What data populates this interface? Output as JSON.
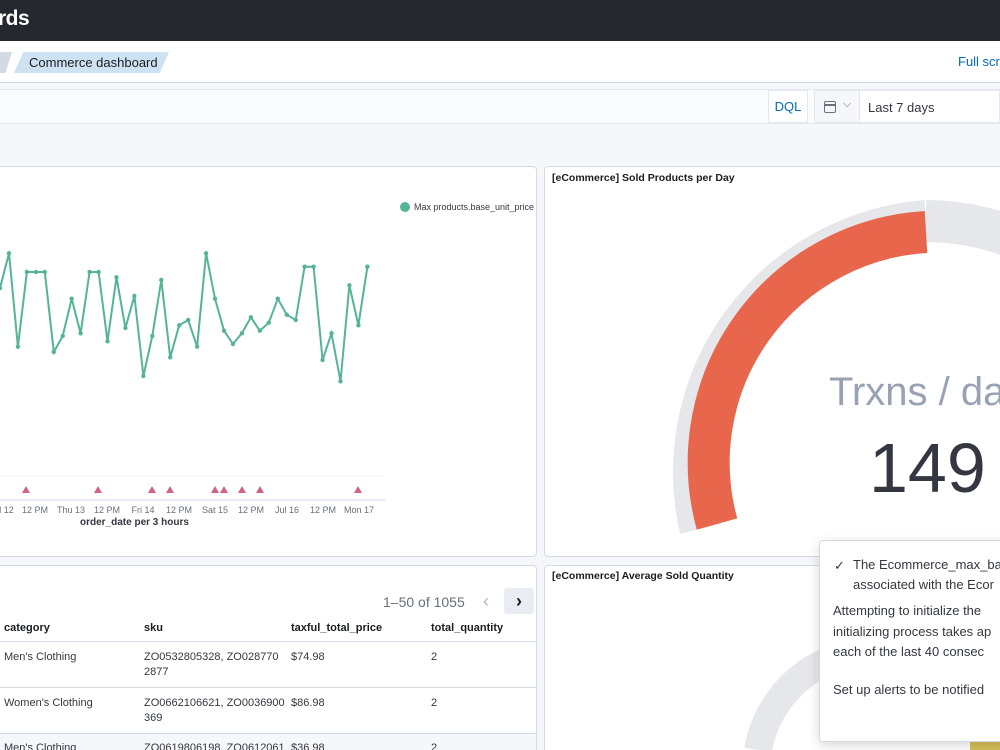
{
  "header": {
    "title": "rds"
  },
  "breadcrumb": {
    "current": "Commerce dashboard",
    "full_screen": "Full scre"
  },
  "query": {
    "language": "DQL",
    "date_range": "Last 7 days"
  },
  "line_panel": {
    "legend": "Max products.base_unit_price",
    "x_axis_title": "order_date per 3 hours",
    "x_ticks": [
      "d 12",
      "12 PM",
      "Thu 13",
      "12 PM",
      "Fri 14",
      "12 PM",
      "Sat 15",
      "12 PM",
      "Jul 16",
      "12 PM",
      "Mon 17"
    ]
  },
  "gauge_panel": {
    "title": "[eCommerce] Sold Products per Day",
    "label": "Trxns / da",
    "value": "149"
  },
  "avg_panel": {
    "title": "[eCommerce] Average Sold Quantity"
  },
  "table": {
    "pagination": "1–50 of 1055",
    "columns": [
      "category",
      "sku",
      "taxful_total_price",
      "total_quantity"
    ],
    "rows": [
      {
        "category": "Men's Clothing",
        "sku_line1": "ZO0532805328, ZO028770",
        "sku_line2": "2877",
        "price": "$74.98",
        "qty": "2"
      },
      {
        "category": "Women's Clothing",
        "sku_line1": "ZO0662106621, ZO0036900",
        "sku_line2": "369",
        "price": "$86.98",
        "qty": "2"
      },
      {
        "category": "Men's Clothing",
        "sku_line1": "ZO0619806198, ZO0612061",
        "sku_line2": "",
        "price": "$36.98",
        "qty": "2"
      }
    ]
  },
  "toast": {
    "lines": [
      "The Ecommerce_max_ba",
      "associated with the Ecor",
      "Attempting to initialize the",
      "initializing process takes ap",
      "each of the last 40 consec",
      "Set up alerts to be notified"
    ]
  },
  "colors": {
    "line": "#54b399",
    "gauge": "#e7664c",
    "annotation": "#d36086"
  },
  "chart_data": {
    "type": "line",
    "x_axis_title": "order_date per 3 hours",
    "series": [
      {
        "name": "Max products.base_unit_price",
        "values": [
          72,
          85,
          50,
          78,
          78,
          78,
          48,
          54,
          68,
          55,
          78,
          78,
          52,
          76,
          57,
          69,
          39,
          54,
          75,
          46,
          58,
          60,
          50,
          85,
          68,
          56,
          51,
          55,
          61,
          56,
          59,
          68,
          62,
          60,
          80,
          80,
          45,
          55,
          37,
          73,
          58,
          80
        ]
      }
    ],
    "annotations": [
      "d 12",
      "12 PM",
      "Fri 14",
      "12 PM",
      "Sat 15",
      "Sat 15",
      "12 PM",
      "12 PM",
      "Mon 17"
    ],
    "grid": false,
    "legend": "top-right"
  }
}
